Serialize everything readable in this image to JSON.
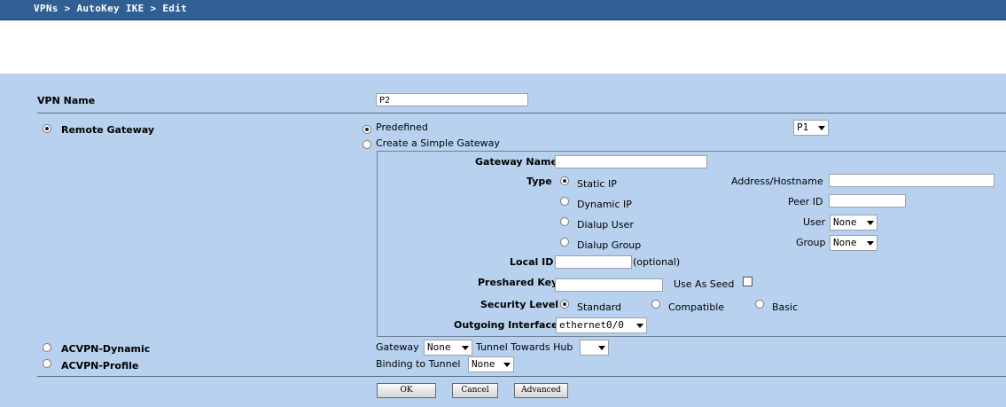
{
  "breadcrumb": "VPNs > AutoKey IKE > Edit",
  "vpn_name": {
    "label": "VPN Name",
    "value": "P2"
  },
  "remote_gateway": {
    "label": "Remote Gateway",
    "predefined_label": "Predefined",
    "predefined_value": "P1",
    "simple_label": "Create a Simple Gateway"
  },
  "gateway": {
    "name_label": "Gateway Name",
    "type_label": "Type",
    "types": [
      "Static IP",
      "Dynamic IP",
      "Dialup User",
      "Dialup Group"
    ],
    "address_label": "Address/Hostname",
    "peer_id_label": "Peer ID",
    "user_label": "User",
    "user_value": "None",
    "group_label": "Group",
    "group_value": "None",
    "local_id_label": "Local ID",
    "local_id_hint": "(optional)",
    "psk_label": "Preshared Key",
    "seed_label": "Use As Seed",
    "security_label": "Security Level",
    "security_options": [
      "Standard",
      "Compatible",
      "Basic"
    ],
    "outgoing_label": "Outgoing Interface",
    "outgoing_value": "ethernet0/0"
  },
  "acvpn": {
    "dynamic_label": "ACVPN-Dynamic",
    "profile_label": "ACVPN-Profile",
    "gateway_label": "Gateway",
    "gateway_value": "None",
    "tunnel_hub_label": "Tunnel Towards Hub",
    "tunnel_hub_value": "",
    "binding_label": "Binding to Tunnel",
    "binding_value": "None"
  },
  "buttons": {
    "ok": "OK",
    "cancel": "Cancel",
    "advanced": "Advanced"
  }
}
